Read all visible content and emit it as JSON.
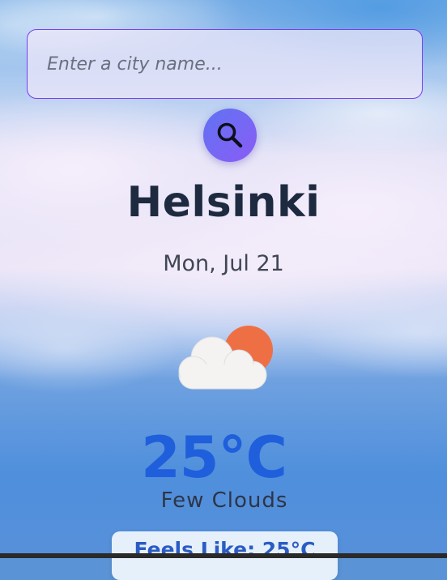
{
  "search": {
    "placeholder": "Enter a city name...",
    "value": "",
    "button_icon": "search-icon"
  },
  "weather": {
    "city": "Helsinki",
    "date": "Mon, Jul 21",
    "icon": "few-clouds-icon",
    "temperature": "25°C",
    "condition": "Few Clouds",
    "feels_like": "Feels Like: 25°C"
  },
  "colors": {
    "accent": "#7b3df0",
    "temperature": "#1f5fdc",
    "city": "#1e2a3f",
    "sun": "#ef6f45"
  }
}
